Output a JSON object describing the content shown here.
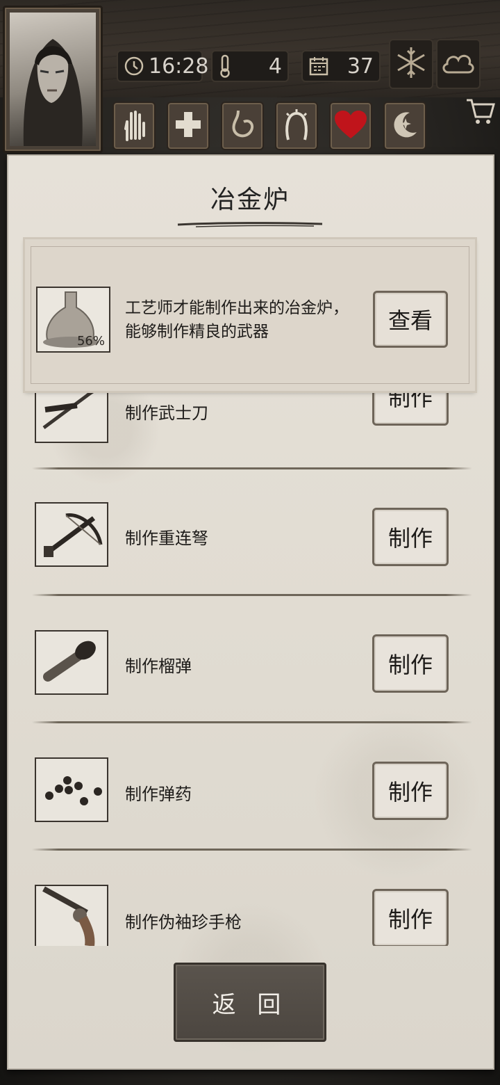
{
  "header": {
    "time": "16:28",
    "temperature": "4",
    "day": "37",
    "weather_icons": [
      "snowflake-icon",
      "cloud-icon"
    ],
    "status_icons": [
      "hand-icon",
      "medical-cross-icon",
      "stomach-icon",
      "head-icon",
      "heart-icon",
      "moon-star-icon"
    ]
  },
  "panel": {
    "title": "冶金炉",
    "featured": {
      "description_line1": "工艺师才能制作出来的冶金炉，",
      "description_line2": "能够制作精良的武器",
      "progress": "56%",
      "button": "查看",
      "icon": "furnace-icon"
    },
    "items": [
      {
        "label": "制作武士刀",
        "button": "制作",
        "icon": "katana-icon"
      },
      {
        "label": "制作重连弩",
        "button": "制作",
        "icon": "crossbow-icon"
      },
      {
        "label": "制作榴弹",
        "button": "制作",
        "icon": "grenade-icon"
      },
      {
        "label": "制作弹药",
        "button": "制作",
        "icon": "ammo-icon"
      },
      {
        "label": "制作伪袖珍手枪",
        "button": "制作",
        "icon": "revolver-icon"
      }
    ],
    "back_button": "返 回"
  },
  "colors": {
    "paper": "#e3ded5",
    "heart": "#c0141b",
    "button_border": "#6e6559",
    "back_button": "#514b45"
  }
}
